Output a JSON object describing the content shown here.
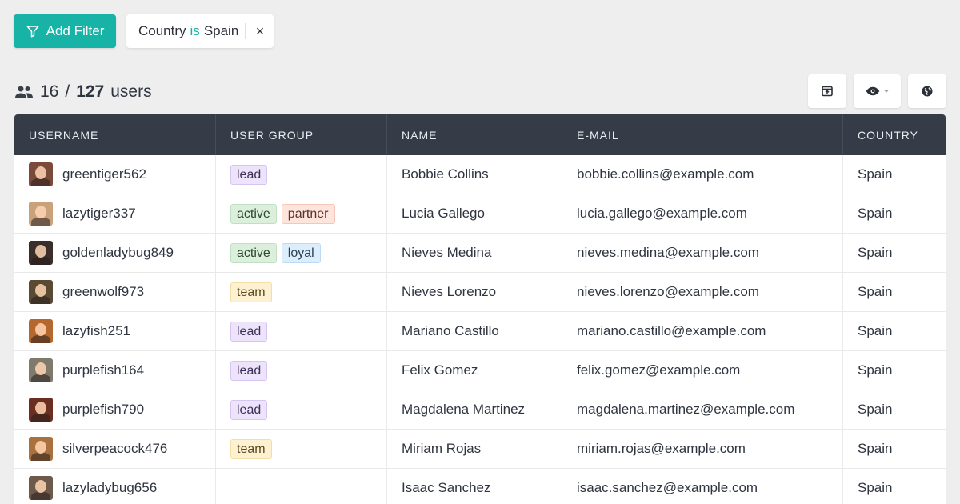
{
  "filter": {
    "add_label": "Add Filter",
    "chip_field": "Country",
    "chip_op": "is",
    "chip_value": "Spain",
    "chip_remove": "×"
  },
  "summary": {
    "shown": "16",
    "separator": "/",
    "total": "127",
    "unit": "users"
  },
  "toolbar": {
    "icons": [
      "export-icon",
      "eye-icon",
      "globe-icon"
    ]
  },
  "table": {
    "columns": [
      "USERNAME",
      "USER GROUP",
      "NAME",
      "E-MAIL",
      "COUNTRY"
    ],
    "rows": [
      {
        "username": "greentiger562",
        "groups": [
          "lead"
        ],
        "name": "Bobbie Collins",
        "email": "bobbie.collins@example.com",
        "country": "Spain",
        "avatar_color": "#7b4a3a"
      },
      {
        "username": "lazytiger337",
        "groups": [
          "active",
          "partner"
        ],
        "name": "Lucia Gallego",
        "email": "lucia.gallego@example.com",
        "country": "Spain",
        "avatar_color": "#c9a27c"
      },
      {
        "username": "goldenladybug849",
        "groups": [
          "active",
          "loyal"
        ],
        "name": "Nieves Medina",
        "email": "nieves.medina@example.com",
        "country": "Spain",
        "avatar_color": "#3b2e2a"
      },
      {
        "username": "greenwolf973",
        "groups": [
          "team"
        ],
        "name": "Nieves Lorenzo",
        "email": "nieves.lorenzo@example.com",
        "country": "Spain",
        "avatar_color": "#5a4a33"
      },
      {
        "username": "lazyfish251",
        "groups": [
          "lead"
        ],
        "name": "Mariano Castillo",
        "email": "mariano.castillo@example.com",
        "country": "Spain",
        "avatar_color": "#b5682e"
      },
      {
        "username": "purplefish164",
        "groups": [
          "lead"
        ],
        "name": "Felix Gomez",
        "email": "felix.gomez@example.com",
        "country": "Spain",
        "avatar_color": "#7f7a6c"
      },
      {
        "username": "purplefish790",
        "groups": [
          "lead"
        ],
        "name": "Magdalena Martinez",
        "email": "magdalena.martinez@example.com",
        "country": "Spain",
        "avatar_color": "#6b2f22"
      },
      {
        "username": "silverpeacock476",
        "groups": [
          "team"
        ],
        "name": "Miriam Rojas",
        "email": "miriam.rojas@example.com",
        "country": "Spain",
        "avatar_color": "#a8713d"
      },
      {
        "username": "lazyladybug656",
        "groups": [],
        "name": "Isaac Sanchez",
        "email": "isaac.sanchez@example.com",
        "country": "Spain",
        "avatar_color": "#6d5a4b"
      }
    ]
  },
  "tag_colors": {
    "lead": {
      "bg": "#ede4fb",
      "border": "#d6c5f2",
      "fg": "#3c2f55"
    },
    "active": {
      "bg": "#dcefdc",
      "border": "#c1e0c1",
      "fg": "#2c4a2c"
    },
    "partner": {
      "bg": "#fde4dc",
      "border": "#f6c7b7",
      "fg": "#5a3328"
    },
    "loyal": {
      "bg": "#dcedfb",
      "border": "#bcdaf3",
      "fg": "#2a4258"
    },
    "team": {
      "bg": "#fdf1d2",
      "border": "#f2dfa6",
      "fg": "#5a4a1d"
    }
  },
  "colors": {
    "accent": "#17b3a6",
    "header_bg": "#353c47"
  }
}
